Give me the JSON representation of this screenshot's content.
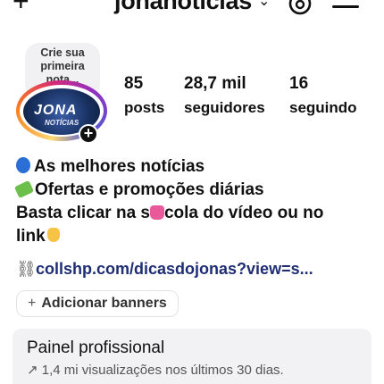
{
  "header": {
    "username": "jonanoticias",
    "plus_icon": "plus-icon",
    "threads_icon": "threads-icon",
    "menu_icon": "menu-icon"
  },
  "note": {
    "text_line1": "Crie sua",
    "text_line2": "primeira",
    "text_line3": "nota..."
  },
  "avatar": {
    "text": "JONA",
    "subtext": "NOTÍCIAS"
  },
  "stats": [
    {
      "value": "85",
      "label": "posts"
    },
    {
      "value": "28,7 mil",
      "label": "seguidores"
    },
    {
      "value": "16",
      "label": "seguindo"
    }
  ],
  "bio": {
    "line1": "As melhores notícias",
    "line2": "Ofertas e promoções diárias",
    "line3_a": " Basta clicar na s",
    "line3_b": "cola do vídeo ou no",
    "line4": "link"
  },
  "link": {
    "url": "collshp.com/dicasdojonas?view=s..."
  },
  "banners": {
    "label": "Adicionar banners"
  },
  "panel": {
    "title": "Painel profissional",
    "subtitle": "1,4 mi visualizações nos últimos 30 dias."
  }
}
